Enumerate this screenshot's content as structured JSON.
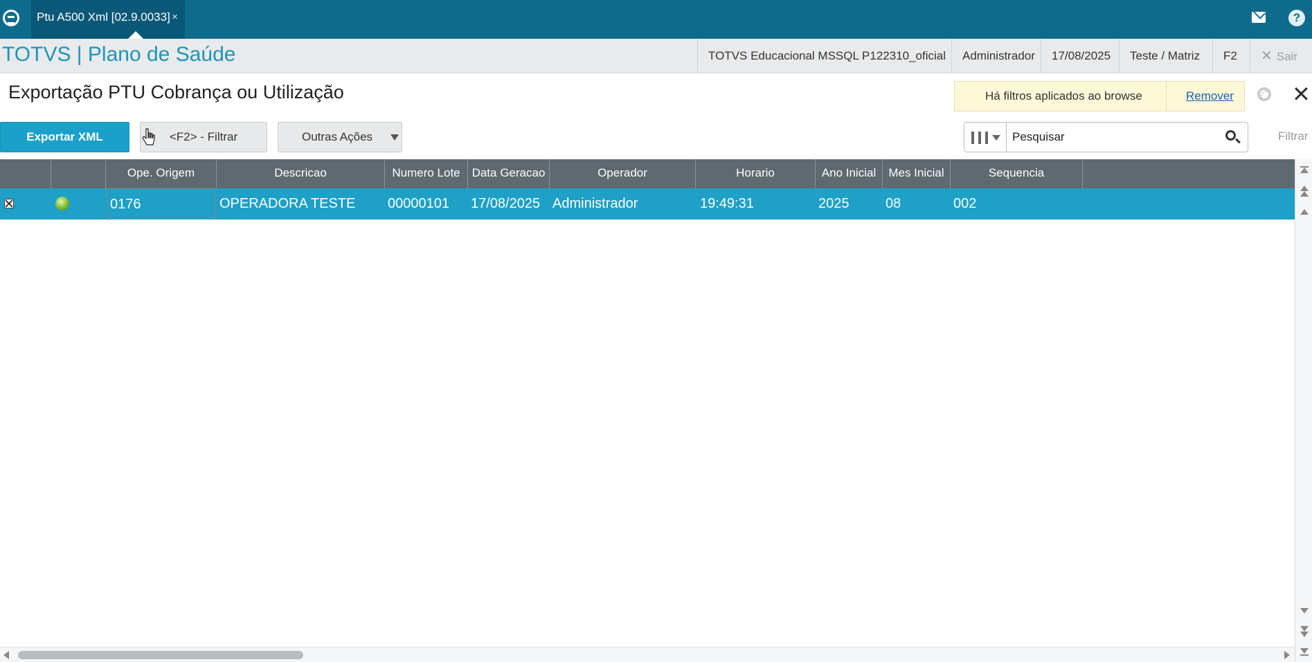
{
  "topbar": {
    "tab_label": "Ptu A500 Xml [02.9.0033]",
    "tab_close": "×",
    "help_label": "?"
  },
  "header": {
    "app_title": "TOTVS | Plano de Saúde",
    "environment": "TOTVS Educacional MSSQL P122310_oficial",
    "user": "Administrador",
    "date": "17/08/2025",
    "branch": "Teste / Matriz",
    "shortcut": "F2",
    "exit_label": "Sair"
  },
  "page": {
    "title": "Exportação PTU Cobrança ou Utilização",
    "filter_notice": "Há filtros aplicados ao browse",
    "filter_remove": "Remover"
  },
  "toolbar": {
    "export_label": "Exportar XML",
    "filter_label": "<F2> - Filtrar",
    "more_label": "Outras Ações",
    "search_placeholder": "Pesquisar",
    "filtrar_link": "Filtrar"
  },
  "grid": {
    "columns": [
      "Ope. Origem",
      "Descricao",
      "Numero Lote",
      "Data Geracao",
      "Operador",
      "Horario",
      "Ano Inicial",
      "Mes Inicial",
      "Sequencia"
    ],
    "rows": [
      {
        "ope_origem": "0176",
        "descricao": "OPERADORA TESTE",
        "numero_lote": "00000101",
        "data_geracao": "17/08/2025",
        "operador": "Administrador",
        "horario": "19:49:31",
        "ano_inicial": "2025",
        "mes_inicial": "08",
        "sequencia": "002"
      }
    ]
  },
  "colors": {
    "topbar": "#0f6b8c",
    "accent": "#1aa0c9",
    "selected_row": "#1ea0c7",
    "grid_header": "#5f6970"
  }
}
